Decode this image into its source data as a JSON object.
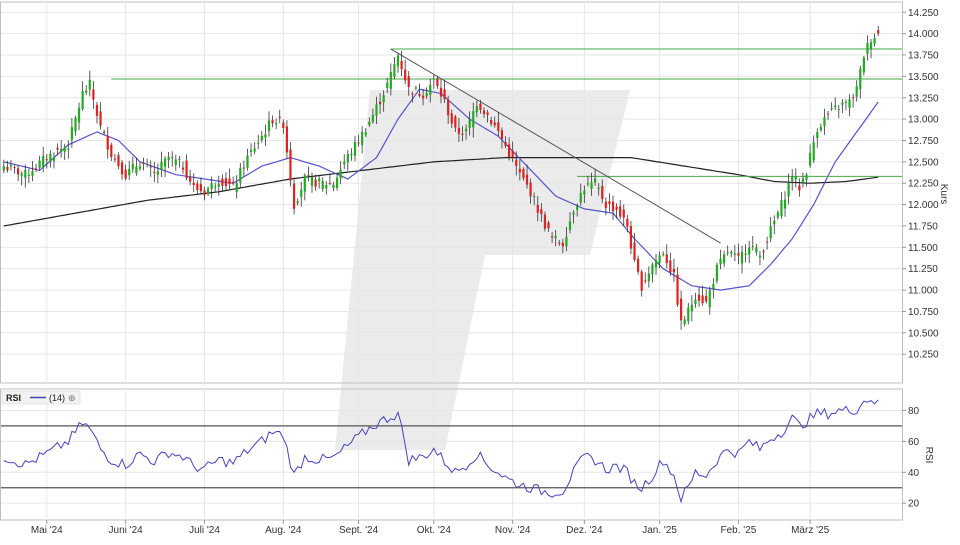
{
  "chart_data": [
    {
      "type": "candlestick",
      "panel": "price",
      "ylabel": "Kurs",
      "ylim": [
        10.1,
        14.3
      ],
      "yticks": [
        "14.250",
        "14.000",
        "13.750",
        "13.500",
        "13.250",
        "13.000",
        "12.750",
        "12.500",
        "12.250",
        "12.000",
        "11.750",
        "11.500",
        "11.250",
        "11.000",
        "10.750",
        "10.500",
        "10.250"
      ],
      "ytick_values": [
        14.25,
        14.0,
        13.75,
        13.5,
        13.25,
        13.0,
        12.75,
        12.5,
        12.25,
        12.0,
        11.75,
        11.5,
        11.25,
        11.0,
        10.75,
        10.5,
        10.25
      ],
      "xticks": [
        "Mai '24",
        "Juni '24",
        "Juli '24",
        "Aug. '24",
        "Sept. '24",
        "Okt. '24",
        "Nov. '24",
        "Dez. '24",
        "Jan. '25",
        "Feb. '25",
        "März '25"
      ],
      "xtick_index": [
        12,
        34,
        56,
        78,
        99,
        120,
        142,
        162,
        183,
        205,
        225
      ],
      "n_points": 245,
      "close_anchors": [
        [
          0,
          12.45
        ],
        [
          6,
          12.35
        ],
        [
          12,
          12.55
        ],
        [
          18,
          12.7
        ],
        [
          22,
          13.3
        ],
        [
          24,
          13.4
        ],
        [
          27,
          12.9
        ],
        [
          30,
          12.6
        ],
        [
          34,
          12.35
        ],
        [
          38,
          12.5
        ],
        [
          42,
          12.35
        ],
        [
          46,
          12.55
        ],
        [
          50,
          12.45
        ],
        [
          53,
          12.2
        ],
        [
          56,
          12.15
        ],
        [
          60,
          12.3
        ],
        [
          64,
          12.2
        ],
        [
          68,
          12.55
        ],
        [
          72,
          12.8
        ],
        [
          75,
          13.0
        ],
        [
          78,
          12.95
        ],
        [
          81,
          12.0
        ],
        [
          84,
          12.3
        ],
        [
          88,
          12.25
        ],
        [
          92,
          12.25
        ],
        [
          95,
          12.5
        ],
        [
          99,
          12.75
        ],
        [
          103,
          13.05
        ],
        [
          107,
          13.4
        ],
        [
          110,
          13.75
        ],
        [
          113,
          13.35
        ],
        [
          117,
          13.3
        ],
        [
          120,
          13.45
        ],
        [
          123,
          13.2
        ],
        [
          126,
          12.85
        ],
        [
          129,
          12.85
        ],
        [
          132,
          13.2
        ],
        [
          135,
          13.05
        ],
        [
          138,
          12.85
        ],
        [
          141,
          12.6
        ],
        [
          144,
          12.35
        ],
        [
          147,
          12.15
        ],
        [
          150,
          11.85
        ],
        [
          153,
          11.6
        ],
        [
          156,
          11.55
        ],
        [
          159,
          11.95
        ],
        [
          162,
          12.2
        ],
        [
          165,
          12.25
        ],
        [
          168,
          12.0
        ],
        [
          171,
          11.95
        ],
        [
          174,
          11.75
        ],
        [
          176,
          11.3
        ],
        [
          178,
          11.05
        ],
        [
          181,
          11.3
        ],
        [
          184,
          11.45
        ],
        [
          187,
          11.15
        ],
        [
          189,
          10.6
        ],
        [
          191,
          10.75
        ],
        [
          193,
          10.95
        ],
        [
          196,
          10.85
        ],
        [
          199,
          11.25
        ],
        [
          202,
          11.45
        ],
        [
          205,
          11.35
        ],
        [
          208,
          11.55
        ],
        [
          211,
          11.4
        ],
        [
          214,
          11.7
        ],
        [
          217,
          12.0
        ],
        [
          220,
          12.35
        ],
        [
          222,
          12.2
        ],
        [
          224,
          12.4
        ],
        [
          227,
          12.9
        ],
        [
          230,
          13.05
        ],
        [
          233,
          13.15
        ],
        [
          236,
          13.2
        ],
        [
          238,
          13.35
        ],
        [
          240,
          13.75
        ],
        [
          242,
          13.95
        ],
        [
          244,
          14.0
        ]
      ],
      "series": [
        {
          "name": "",
          "kind": "moving-average",
          "color": "#5555cc",
          "anchors": [
            [
              0,
              12.5
            ],
            [
              10,
              12.4
            ],
            [
              18,
              12.7
            ],
            [
              26,
              12.85
            ],
            [
              32,
              12.75
            ],
            [
              38,
              12.5
            ],
            [
              48,
              12.35
            ],
            [
              56,
              12.3
            ],
            [
              64,
              12.25
            ],
            [
              72,
              12.45
            ],
            [
              80,
              12.55
            ],
            [
              88,
              12.45
            ],
            [
              96,
              12.3
            ],
            [
              104,
              12.55
            ],
            [
              110,
              13.0
            ],
            [
              116,
              13.35
            ],
            [
              122,
              13.3
            ],
            [
              130,
              13.0
            ],
            [
              138,
              12.8
            ],
            [
              146,
              12.45
            ],
            [
              154,
              12.1
            ],
            [
              162,
              11.95
            ],
            [
              170,
              11.9
            ],
            [
              176,
              11.6
            ],
            [
              184,
              11.25
            ],
            [
              192,
              11.05
            ],
            [
              200,
              11.0
            ],
            [
              208,
              11.05
            ],
            [
              214,
              11.3
            ],
            [
              220,
              11.6
            ],
            [
              226,
              12.0
            ],
            [
              232,
              12.5
            ],
            [
              238,
              12.85
            ],
            [
              244,
              13.2
            ]
          ]
        },
        {
          "name": "",
          "kind": "moving-average",
          "color": "#222222",
          "anchors": [
            [
              0,
              11.75
            ],
            [
              20,
              11.9
            ],
            [
              40,
              12.05
            ],
            [
              60,
              12.15
            ],
            [
              80,
              12.3
            ],
            [
              100,
              12.4
            ],
            [
              120,
              12.5
            ],
            [
              140,
              12.55
            ],
            [
              160,
              12.55
            ],
            [
              175,
              12.55
            ],
            [
              190,
              12.45
            ],
            [
              205,
              12.35
            ],
            [
              215,
              12.27
            ],
            [
              225,
              12.25
            ],
            [
              235,
              12.27
            ],
            [
              244,
              12.32
            ]
          ]
        }
      ],
      "horizontal_lines": [
        13.82,
        13.47,
        12.33
      ],
      "trendline": [
        [
          108,
          13.82
        ],
        [
          200,
          11.55
        ]
      ]
    },
    {
      "type": "line",
      "panel": "indicator",
      "title": "RSI",
      "legend": "(14)",
      "ylabel": "RSI",
      "ylim": [
        13,
        90
      ],
      "yticks": [
        "80",
        "60",
        "40",
        "20"
      ],
      "ytick_values": [
        80,
        60,
        40,
        20
      ],
      "hlines": [
        70,
        30
      ],
      "color": "#4444bb",
      "anchors": [
        [
          0,
          50
        ],
        [
          6,
          45
        ],
        [
          12,
          52
        ],
        [
          18,
          60
        ],
        [
          22,
          72
        ],
        [
          24,
          68
        ],
        [
          27,
          55
        ],
        [
          30,
          48
        ],
        [
          34,
          45
        ],
        [
          38,
          52
        ],
        [
          42,
          47
        ],
        [
          46,
          53
        ],
        [
          50,
          50
        ],
        [
          53,
          44
        ],
        [
          56,
          42
        ],
        [
          60,
          48
        ],
        [
          64,
          46
        ],
        [
          68,
          54
        ],
        [
          72,
          60
        ],
        [
          75,
          66
        ],
        [
          78,
          64
        ],
        [
          81,
          38
        ],
        [
          84,
          50
        ],
        [
          88,
          48
        ],
        [
          92,
          49
        ],
        [
          95,
          55
        ],
        [
          99,
          63
        ],
        [
          103,
          70
        ],
        [
          107,
          75
        ],
        [
          110,
          78
        ],
        [
          113,
          48
        ],
        [
          117,
          50
        ],
        [
          120,
          55
        ],
        [
          123,
          47
        ],
        [
          126,
          40
        ],
        [
          129,
          45
        ],
        [
          132,
          52
        ],
        [
          135,
          45
        ],
        [
          138,
          40
        ],
        [
          141,
          35
        ],
        [
          144,
          32
        ],
        [
          147,
          30
        ],
        [
          150,
          28
        ],
        [
          153,
          27
        ],
        [
          156,
          28
        ],
        [
          159,
          40
        ],
        [
          162,
          50
        ],
        [
          165,
          48
        ],
        [
          168,
          42
        ],
        [
          171,
          44
        ],
        [
          174,
          40
        ],
        [
          176,
          33
        ],
        [
          178,
          30
        ],
        [
          181,
          38
        ],
        [
          184,
          48
        ],
        [
          187,
          38
        ],
        [
          189,
          23
        ],
        [
          191,
          30
        ],
        [
          193,
          40
        ],
        [
          196,
          38
        ],
        [
          199,
          48
        ],
        [
          202,
          55
        ],
        [
          205,
          52
        ],
        [
          208,
          60
        ],
        [
          211,
          55
        ],
        [
          214,
          62
        ],
        [
          217,
          66
        ],
        [
          220,
          75
        ],
        [
          222,
          70
        ],
        [
          224,
          73
        ],
        [
          227,
          78
        ],
        [
          230,
          78
        ],
        [
          233,
          80
        ],
        [
          236,
          80
        ],
        [
          238,
          81
        ],
        [
          240,
          86
        ],
        [
          242,
          88
        ],
        [
          244,
          84
        ]
      ]
    }
  ]
}
